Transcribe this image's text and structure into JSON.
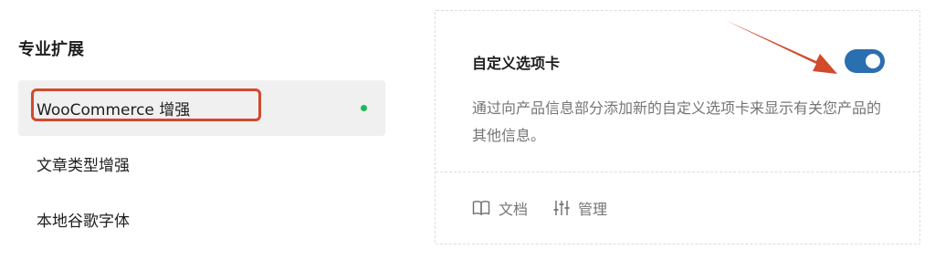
{
  "section": {
    "title": "专业扩展"
  },
  "nav": {
    "items": [
      {
        "label": "WooCommerce 增强",
        "active": true,
        "status": "enabled"
      },
      {
        "label": "文章类型增强"
      },
      {
        "label": "本地谷歌字体"
      }
    ]
  },
  "card": {
    "title": "自定义选项卡",
    "toggle": {
      "on": true
    },
    "description": "通过向产品信息部分添加新的自定义选项卡来显示有关您产品的其他信息。",
    "footer": {
      "docs": {
        "label": "文档",
        "icon": "book-icon"
      },
      "manage": {
        "label": "管理",
        "icon": "sliders-icon"
      }
    }
  },
  "colors": {
    "toggle_on": "#2a6fb0",
    "status_dot": "#1fb85a",
    "annotation": "#d14a2c",
    "muted_text": "#757575"
  }
}
